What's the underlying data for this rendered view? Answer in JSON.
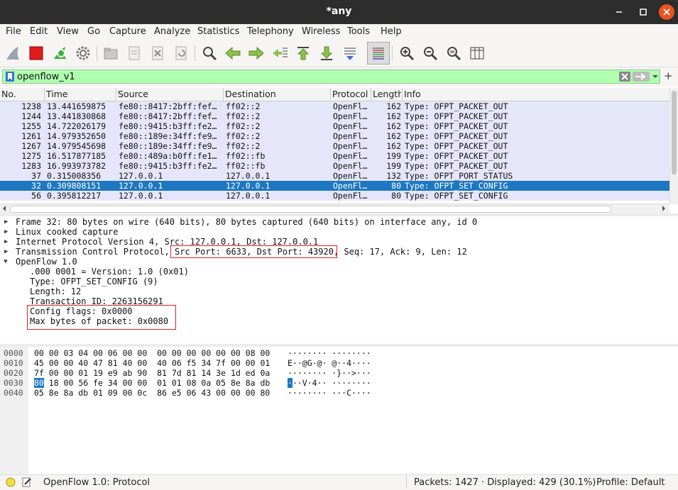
{
  "window": {
    "title": "*any"
  },
  "menu": [
    "File",
    "Edit",
    "View",
    "Go",
    "Capture",
    "Analyze",
    "Statistics",
    "Telephony",
    "Wireless",
    "Tools",
    "Help"
  ],
  "filter": {
    "value": "openflow_v1"
  },
  "columns": [
    "No.",
    "Time",
    "Source",
    "Destination",
    "Protocol",
    "Length",
    "Info"
  ],
  "packets": [
    {
      "no": "1238",
      "time": "13.441659875",
      "src": "fe80::8417:2bff:fef…",
      "dst": "ff02::2",
      "proto": "OpenFl…",
      "len": "162",
      "info": "Type: OFPT_PACKET_OUT"
    },
    {
      "no": "1244",
      "time": "13.441830868",
      "src": "fe80::8417:2bff:fef…",
      "dst": "ff02::2",
      "proto": "OpenFl…",
      "len": "162",
      "info": "Type: OFPT_PACKET_OUT"
    },
    {
      "no": "1255",
      "time": "14.722026179",
      "src": "fe80::9415:b3ff:fe2…",
      "dst": "ff02::2",
      "proto": "OpenFl…",
      "len": "162",
      "info": "Type: OFPT_PACKET_OUT"
    },
    {
      "no": "1261",
      "time": "14.979352650",
      "src": "fe80::189e:34ff:fe9…",
      "dst": "ff02::2",
      "proto": "OpenFl…",
      "len": "162",
      "info": "Type: OFPT_PACKET_OUT"
    },
    {
      "no": "1267",
      "time": "14.979545698",
      "src": "fe80::189e:34ff:fe9…",
      "dst": "ff02::2",
      "proto": "OpenFl…",
      "len": "162",
      "info": "Type: OFPT_PACKET_OUT"
    },
    {
      "no": "1275",
      "time": "16.517877185",
      "src": "fe80::489a:b0ff:fe1…",
      "dst": "ff02::fb",
      "proto": "OpenFl…",
      "len": "199",
      "info": "Type: OFPT_PACKET_OUT"
    },
    {
      "no": "1283",
      "time": "16.993973782",
      "src": "fe80::9415:b3ff:fe2…",
      "dst": "ff02::fb",
      "proto": "OpenFl…",
      "len": "199",
      "info": "Type: OFPT_PACKET_OUT"
    },
    {
      "no": "37",
      "time": "0.315008356",
      "src": "127.0.0.1",
      "dst": "127.0.0.1",
      "proto": "OpenFl…",
      "len": "132",
      "info": "Type: OFPT_PORT_STATUS"
    },
    {
      "no": "32",
      "time": "0.309808151",
      "src": "127.0.0.1",
      "dst": "127.0.0.1",
      "proto": "OpenFl…",
      "len": "80",
      "info": "Type: OFPT_SET_CONFIG"
    },
    {
      "no": "56",
      "time": "0.395812217",
      "src": "127.0.0.1",
      "dst": "127.0.0.1",
      "proto": "OpenFl…",
      "len": "80",
      "info": "Type: OFPT_SET_CONFIG"
    }
  ],
  "selected_packet": "32",
  "details": {
    "frame": "Frame 32: 80 bytes on wire (640 bits), 80 bytes captured (640 bits) on interface any, id 0",
    "linux": "Linux cooked capture",
    "ip": "Internet Protocol Version 4, Src: 127.0.0.1, Dst: 127.0.0.1",
    "tcp_prefix": "Transmission Control Protocol,",
    "tcp_ports": "Src Port: 6633, Dst Port: 43920,",
    "tcp_suffix": "Seq: 17, Ack: 9, Len: 12",
    "openflow": "OpenFlow 1.0",
    "version": ".000 0001 = Version: 1.0 (0x01)",
    "type": "Type: OFPT_SET_CONFIG (9)",
    "length": "Length: 12",
    "xid": "Transaction ID: 2263156291",
    "config_flags": "Config flags: 0x0000",
    "max_bytes": "Max bytes of packet: 0x0080"
  },
  "hex": [
    {
      "off": "0000",
      "bytes": "00 00 03 04 00 06 00 00  00 00 00 00 00 00 08 00",
      "ascii": "········ ········"
    },
    {
      "off": "0010",
      "bytes": "45 00 00 40 47 81 40 00  40 06 f5 34 7f 00 00 01",
      "ascii": "E··@G·@· @··4····"
    },
    {
      "off": "0020",
      "bytes": "7f 00 00 01 19 e9 ab 90  81 7d 81 14 3e 1d ed 0a",
      "ascii": "········ ·}··>···"
    },
    {
      "off": "0030",
      "b_hl": "80",
      "bytes": " 18 00 56 fe 34 00 00  01 01 08 0a 05 8e 8a db",
      "a_hl": "·",
      "ascii": "··V·4·· ········"
    },
    {
      "off": "0040",
      "bytes": "05 8e 8a db 01 09 00 0c  86 e5 06 43 00 00 00 80",
      "ascii": "········ ···C····"
    }
  ],
  "status": {
    "protocol": "OpenFlow 1.0: Protocol",
    "packets": "Packets: 1427 · Displayed: 429 (30.1%)",
    "profile": "Profile: Default"
  },
  "colors": {
    "selected": "#1d78c1",
    "filter_ok": "#afffaf",
    "row_bg": "#e6e6fa",
    "annotation": "#d22222"
  }
}
